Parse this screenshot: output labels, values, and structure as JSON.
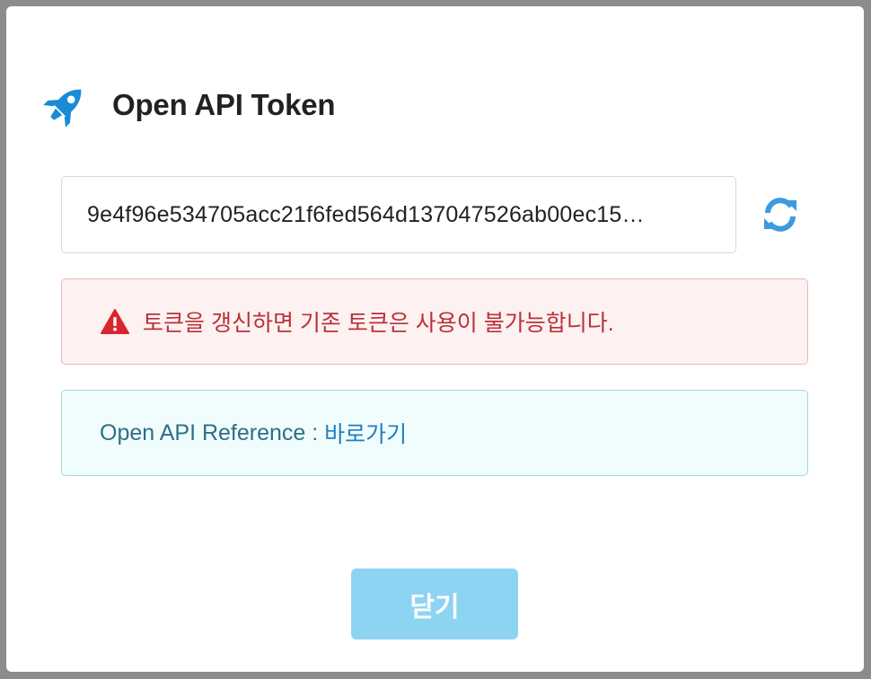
{
  "dialog": {
    "title": "Open API Token",
    "title_icon": "rocket-icon"
  },
  "token": {
    "value": "9e4f96e534705acc21f6fed564d137047526ab00ec15…",
    "refresh_icon": "refresh-icon"
  },
  "warning": {
    "icon": "warning-triangle-icon",
    "text": "토큰을 갱신하면 기존 토큰은 사용이 불가능합니다."
  },
  "info": {
    "label": "Open API Reference : ",
    "link_text": "바로가기"
  },
  "footer": {
    "close_label": "닫기"
  },
  "colors": {
    "accent": "#1a8bd6",
    "warning_text": "#b8323a",
    "info_text": "#2a7185",
    "close_button": "#8dd4f3"
  }
}
